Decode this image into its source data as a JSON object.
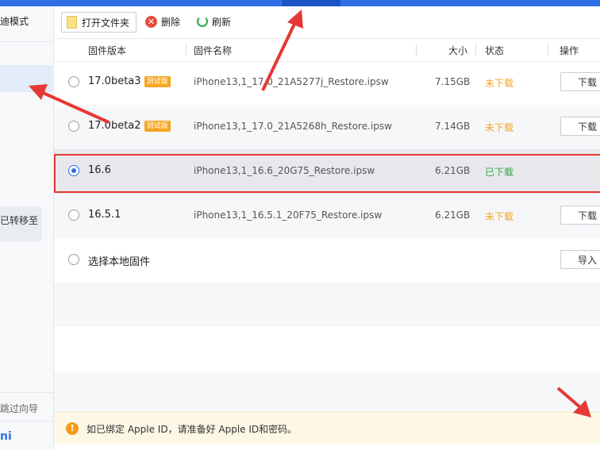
{
  "sidebar": {
    "title": "迪模式",
    "box_text": "已转移至",
    "skip": "跳过向导",
    "user": "ni"
  },
  "toolbar": {
    "open_folder": "打开文件夹",
    "delete": "删除",
    "refresh": "刷新"
  },
  "table": {
    "columns": [
      "固件版本",
      "固件名称",
      "大小",
      "状态",
      "操作"
    ],
    "rows": [
      {
        "version": "17.0beta3",
        "badge": "测试版",
        "name": "iPhone13,1_17.0_21A5277j_Restore.ipsw",
        "size": "7.15GB",
        "status": "未下载",
        "action": "下载"
      },
      {
        "version": "17.0beta2",
        "badge": "测试版",
        "name": "iPhone13,1_17.0_21A5268h_Restore.ipsw",
        "size": "7.14GB",
        "status": "未下载",
        "action": "下载"
      },
      {
        "version": "16.6",
        "name": "iPhone13,1_16.6_20G75_Restore.ipsw",
        "size": "6.21GB",
        "status": "已下载",
        "selected": true
      },
      {
        "version": "16.5.1",
        "name": "iPhone13,1_16.5.1_20F75_Restore.ipsw",
        "size": "6.21GB",
        "status": "未下载",
        "action": "下载"
      },
      {
        "version": "选择本地固件",
        "action": "导入"
      }
    ]
  },
  "notice": "如已绑定 Apple ID，请准备好 Apple ID和密码。",
  "colors": {
    "accent": "#2f6fe6",
    "not_downloaded": "#f5a623",
    "downloaded": "#33a84a",
    "highlight": "#e53935"
  }
}
